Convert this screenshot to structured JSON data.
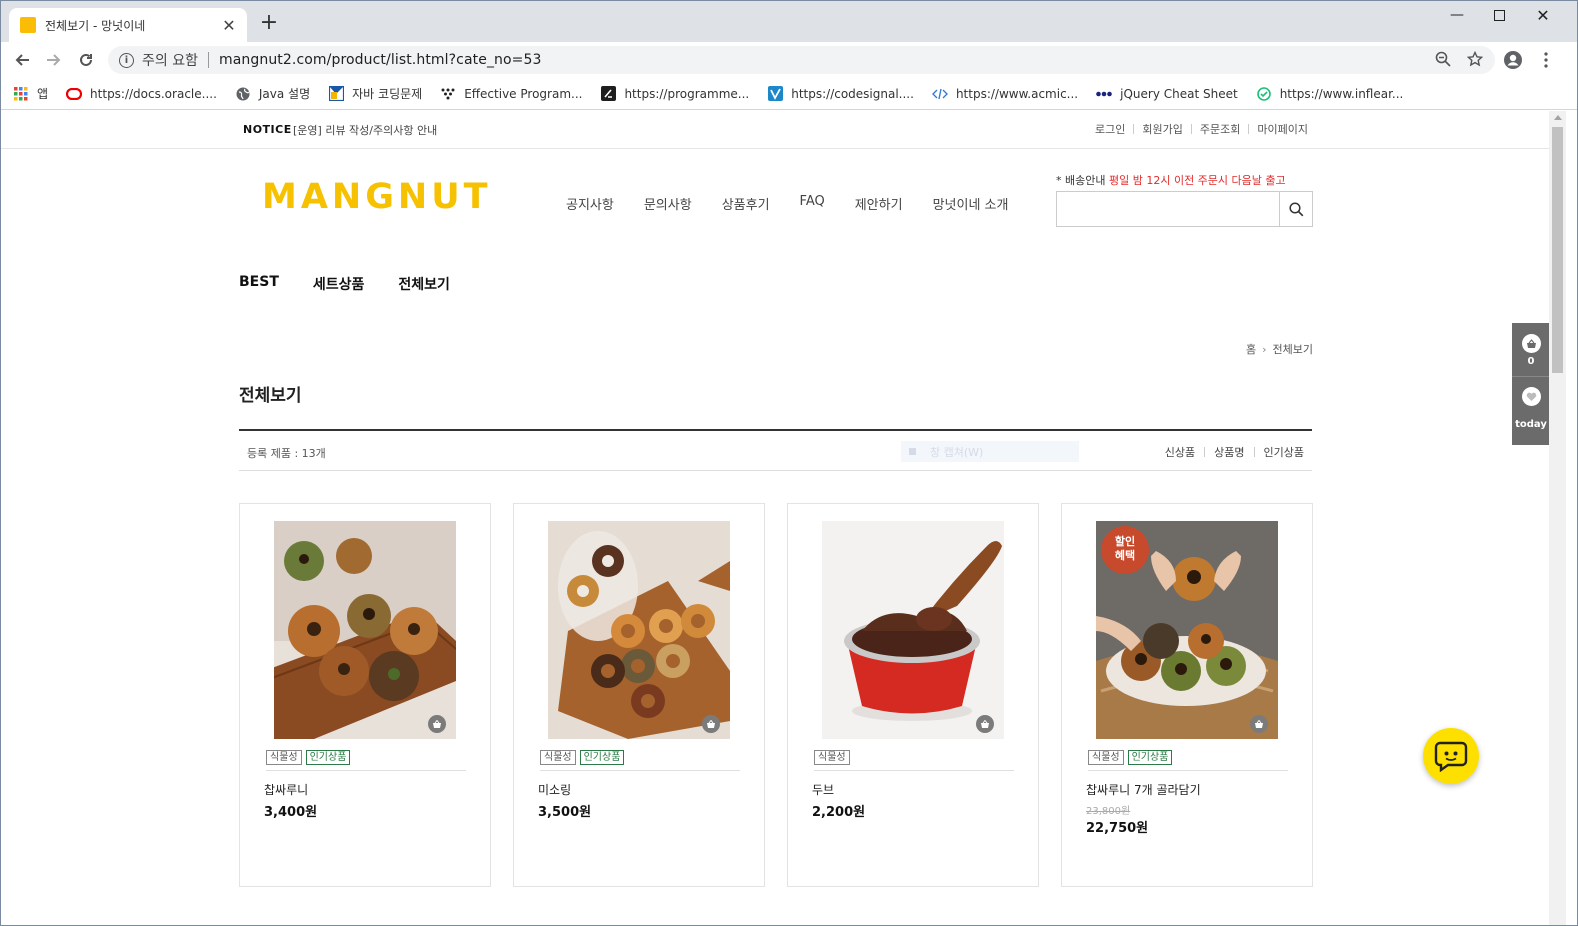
{
  "browser": {
    "tab_title": "전체보기 - 망넛이네",
    "new_tab": "+",
    "security_label": "주의 요함",
    "url": "mangnut2.com/product/list.html?cate_no=53",
    "bookmarks": [
      {
        "label": "앱",
        "icon": "apps-grid-icon"
      },
      {
        "label": "https://docs.oracle....",
        "icon": "oracle-icon"
      },
      {
        "label": "Java 설명",
        "icon": "globe-icon"
      },
      {
        "label": "자바 코딩문제",
        "icon": "bookmark-square-icon"
      },
      {
        "label": "Effective Program...",
        "icon": "dots-icon"
      },
      {
        "label": "https://programme...",
        "icon": "programmers-icon"
      },
      {
        "label": "https://codesignal....",
        "icon": "codesignal-icon"
      },
      {
        "label": "https://www.acmic...",
        "icon": "code-icon"
      },
      {
        "label": "jQuery Cheat Sheet",
        "icon": "dots-icon"
      },
      {
        "label": "https://www.inflear...",
        "icon": "inflearn-icon"
      }
    ]
  },
  "notice": {
    "label": "NOTICE",
    "text": "[운영] 리뷰 작성/주의사항 안내"
  },
  "top_links": [
    "로그인",
    "회원가입",
    "주문조회",
    "마이페이지"
  ],
  "header": {
    "logo": "MANGNUT",
    "gnb": [
      "공지사항",
      "문의사항",
      "상품후기",
      "FAQ",
      "제안하기",
      "망넛이네 소개"
    ],
    "ship_label": "* 배송안내",
    "ship_text": "평일 밤 12시 이전 주문시 다음날 출고",
    "search_placeholder": ""
  },
  "category_menu": [
    "BEST",
    "세트상품",
    "전체보기"
  ],
  "breadcrumb": {
    "home": "홈",
    "current": "전체보기"
  },
  "page_title": "전체보기",
  "list": {
    "count": "등록 제품 : 13개",
    "ghost_text": "창 캡쳐(W)",
    "sort": [
      "신상품",
      "상품명",
      "인기상품"
    ]
  },
  "products": [
    {
      "name": "찹싸루니",
      "price": "3,400원",
      "orig_price": "",
      "sale_badge": "",
      "badges": [
        "식물성",
        "인기상품"
      ]
    },
    {
      "name": "미소링",
      "price": "3,500원",
      "orig_price": "",
      "sale_badge": "",
      "badges": [
        "식물성",
        "인기상품"
      ]
    },
    {
      "name": "두브",
      "price": "2,200원",
      "orig_price": "",
      "sale_badge": "",
      "badges": [
        "식물성"
      ]
    },
    {
      "name": "찹싸루니 7개 골라담기",
      "price": "22,750원",
      "orig_price": "23,800원",
      "sale_badge": "할인\n혜택",
      "badges": [
        "식물성",
        "인기상품"
      ]
    }
  ],
  "quick": {
    "cart_count": "0",
    "today_label": "today"
  },
  "colors": {
    "brand": "#f6c100",
    "notice_red": "#e22b2b",
    "badge_green": "#2b7a47",
    "chat": "#fde000"
  }
}
